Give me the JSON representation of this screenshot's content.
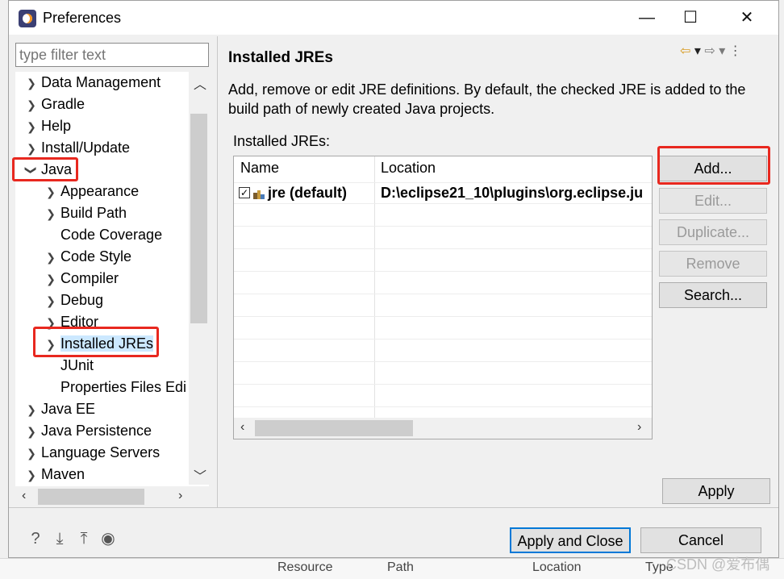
{
  "window": {
    "title": "Preferences"
  },
  "controls": {
    "minimize": "—",
    "maximize": "☐",
    "close": "✕"
  },
  "filter": {
    "placeholder": "type filter text"
  },
  "tree": {
    "items": [
      {
        "label": "Data Management"
      },
      {
        "label": "Gradle"
      },
      {
        "label": "Help"
      },
      {
        "label": "Install/Update"
      },
      {
        "label": "Java"
      },
      {
        "label": "Appearance"
      },
      {
        "label": "Build Path"
      },
      {
        "label": "Code Coverage"
      },
      {
        "label": "Code Style"
      },
      {
        "label": "Compiler"
      },
      {
        "label": "Debug"
      },
      {
        "label": "Editor"
      },
      {
        "label": "Installed JREs"
      },
      {
        "label": "JUnit"
      },
      {
        "label": "Properties Files Edi"
      },
      {
        "label": "Java EE"
      },
      {
        "label": "Java Persistence"
      },
      {
        "label": "Language Servers"
      },
      {
        "label": "Maven"
      }
    ]
  },
  "panel": {
    "title": "Installed JREs",
    "description": "Add, remove or edit JRE definitions. By default, the checked JRE is added to the build path of newly created Java projects.",
    "jres_label": "Installed JREs:",
    "columns": [
      "Name",
      "Location"
    ],
    "rows": [
      {
        "name": "jre (default)",
        "location": "D:\\eclipse21_10\\plugins\\org.eclipse.ju",
        "checked": true
      }
    ],
    "buttons": {
      "add": "Add...",
      "edit": "Edit...",
      "duplicate": "Duplicate...",
      "remove": "Remove",
      "search": "Search..."
    },
    "apply": "Apply"
  },
  "footer": {
    "apply_close": "Apply and Close",
    "cancel": "Cancel"
  },
  "background": {
    "col1": "Resource",
    "col2": "Path",
    "col3": "Location",
    "col4": "Type"
  },
  "watermark": "CSDN @爱布偶",
  "colors": {
    "highlight": "#e8281f",
    "selection": "#cce8ff",
    "focus": "#0078d7"
  }
}
